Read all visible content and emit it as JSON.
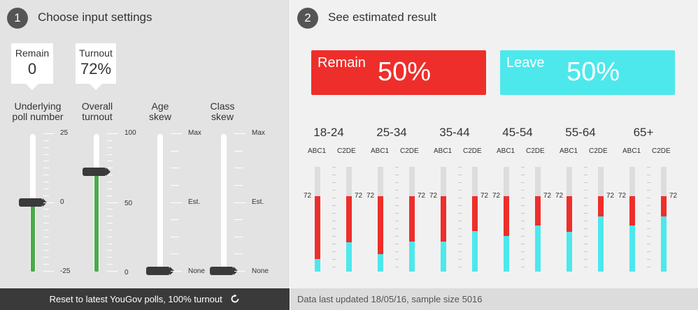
{
  "left": {
    "step": "1",
    "title": "Choose input settings",
    "remain_callout": {
      "label": "Remain",
      "value": "0"
    },
    "turnout_callout": {
      "label": "Turnout",
      "value": "72%"
    },
    "sliders": [
      {
        "label": "Underlying poll number",
        "scale": [
          "25",
          "0",
          "-25"
        ],
        "value": 0,
        "min": -25,
        "max": 25
      },
      {
        "label": "Overall turnout",
        "scale": [
          "100",
          "50",
          "0"
        ],
        "value": 72,
        "min": 0,
        "max": 100
      },
      {
        "label": "Age skew",
        "scale": [
          "Max",
          "Est.",
          "None"
        ],
        "value": 0
      },
      {
        "label": "Class skew",
        "scale": [
          "Max",
          "Est.",
          "None"
        ],
        "value": 0
      }
    ],
    "reset_label": "Reset to latest YouGov polls, 100% turnout"
  },
  "right": {
    "step": "2",
    "title": "See estimated result",
    "remain": {
      "label": "Remain",
      "value": "50%"
    },
    "leave": {
      "label": "Leave",
      "value": "50%"
    },
    "groups": [
      {
        "age": "18-24",
        "bars": [
          {
            "class": "ABC1",
            "turnout": "72",
            "leave": 12,
            "remain": 60
          },
          {
            "class": "C2DE",
            "turnout": "72",
            "leave": 28,
            "remain": 44
          }
        ]
      },
      {
        "age": "25-34",
        "bars": [
          {
            "class": "ABC1",
            "turnout": "72",
            "leave": 17,
            "remain": 55
          },
          {
            "class": "C2DE",
            "turnout": "72",
            "leave": 29,
            "remain": 43
          }
        ]
      },
      {
        "age": "35-44",
        "bars": [
          {
            "class": "ABC1",
            "turnout": "72",
            "leave": 29,
            "remain": 43
          },
          {
            "class": "C2DE",
            "turnout": "72",
            "leave": 39,
            "remain": 33
          }
        ]
      },
      {
        "age": "45-54",
        "bars": [
          {
            "class": "ABC1",
            "turnout": "72",
            "leave": 34,
            "remain": 38
          },
          {
            "class": "C2DE",
            "turnout": "72",
            "leave": 44,
            "remain": 28
          }
        ]
      },
      {
        "age": "55-64",
        "bars": [
          {
            "class": "ABC1",
            "turnout": "72",
            "leave": 38,
            "remain": 34
          },
          {
            "class": "C2DE",
            "turnout": "72",
            "leave": 53,
            "remain": 19
          }
        ]
      },
      {
        "age": "65+",
        "bars": [
          {
            "class": "ABC1",
            "turnout": "72",
            "leave": 44,
            "remain": 28
          },
          {
            "class": "C2DE",
            "turnout": "72",
            "leave": 53,
            "remain": 19
          }
        ]
      }
    ],
    "status": "Data last updated 18/05/16, sample size 5016"
  },
  "colors": {
    "remain": "#ee2e2b",
    "leave": "#4de8ec",
    "turnout_fill": "#4aaa4a",
    "dark": "#3a3a3a"
  },
  "icons": {
    "reset": "refresh-icon"
  }
}
